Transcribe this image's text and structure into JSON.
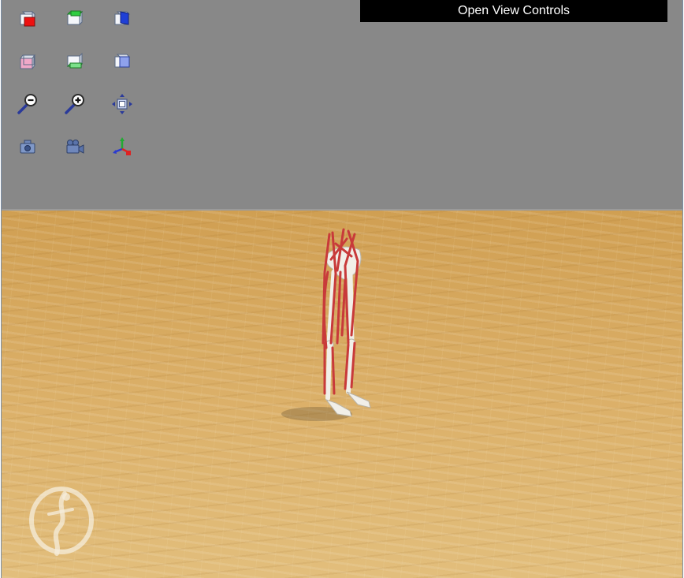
{
  "header": {
    "view_controls_label": "Open View Controls"
  },
  "toolbar": {
    "rows": [
      [
        "cube-red-face-icon",
        "cube-green-face-icon",
        "cube-blue-face-icon"
      ],
      [
        "cube-pink-face-icon",
        "cube-light-green-face-icon",
        "cube-light-blue-face-icon"
      ],
      [
        "zoom-out-icon",
        "zoom-in-icon",
        "fit-to-view-icon"
      ],
      [
        "camera-icon",
        "video-camera-icon",
        "axes-icon"
      ]
    ]
  },
  "scene": {
    "sky_color": "#888888",
    "floor_color": "#d8ad63",
    "muscle_color": "#c83a3a",
    "bone_color": "#f2f0ea"
  }
}
